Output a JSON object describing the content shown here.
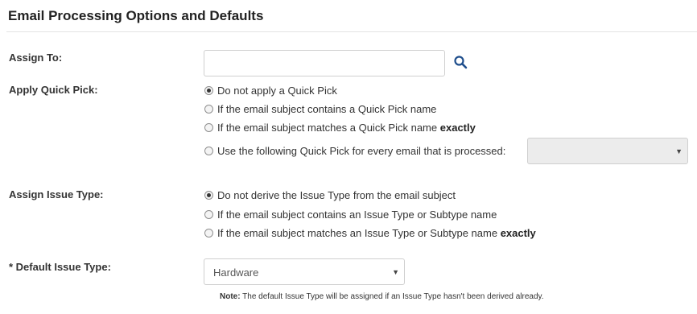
{
  "page": {
    "title": "Email Processing Options and Defaults"
  },
  "assign_to": {
    "label": "Assign To:",
    "value": "",
    "search_icon": "search-icon"
  },
  "apply_quick_pick": {
    "label": "Apply Quick Pick:",
    "options": [
      {
        "text": "Do not apply a Quick Pick",
        "checked": true
      },
      {
        "text": "If the email subject contains a Quick Pick name",
        "checked": false
      },
      {
        "text": "If the email subject matches a Quick Pick name",
        "bold": "exactly",
        "checked": false
      },
      {
        "text": "Use the following Quick Pick for every email that is processed:",
        "checked": false
      }
    ],
    "quick_pick_select_value": ""
  },
  "assign_issue_type": {
    "label": "Assign Issue Type:",
    "options": [
      {
        "text": "Do not derive the Issue Type from the email subject",
        "checked": true
      },
      {
        "text": "If the email subject contains an Issue Type or Subtype name",
        "checked": false
      },
      {
        "text": "If the email subject matches an Issue Type or Subtype name",
        "bold": "exactly",
        "checked": false
      }
    ]
  },
  "default_issue_type": {
    "label": "* Default Issue Type:",
    "value": "Hardware",
    "note_label": "Note:",
    "note_text": "The default Issue Type will be assigned if an Issue Type hasn't been derived already."
  },
  "colors": {
    "accent": "#1f4e8c",
    "border": "#cfcfcf",
    "disabled_bg": "#ececec"
  }
}
